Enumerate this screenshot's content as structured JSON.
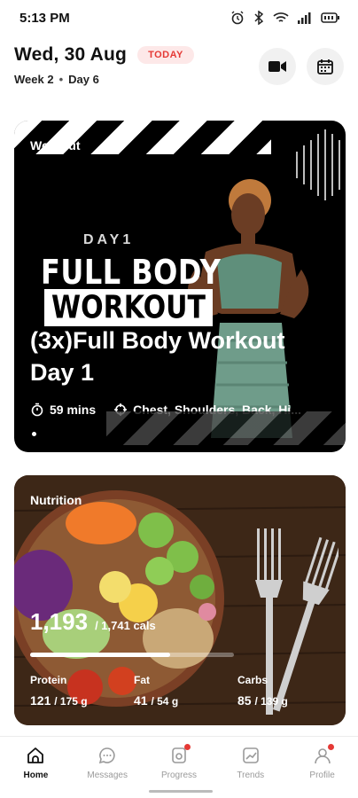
{
  "status_bar": {
    "time": "5:13 PM"
  },
  "header": {
    "date": "Wed, 30 Aug",
    "today_badge": "TODAY",
    "week": "Week 2",
    "separator": "•",
    "day": "Day 6"
  },
  "workout": {
    "section_label": "Workout",
    "banner_day": "DAY1",
    "banner_line1": "FULL BODY",
    "banner_line2": "WORKOUT",
    "title": "(3x)Full Body Workout Day 1",
    "duration": "59 mins",
    "muscles": "Chest, Shoulders, Back, Hi..."
  },
  "nutrition": {
    "section_label": "Nutrition",
    "calories_eaten": "1,193",
    "calories_goal": "/ 1,741 cals",
    "calorie_progress": 0.685,
    "macros": [
      {
        "name": "Protein",
        "value": "121",
        "total": "/ 175 g"
      },
      {
        "name": "Fat",
        "value": "41",
        "total": "/ 54 g"
      },
      {
        "name": "Carbs",
        "value": "85",
        "total": "/ 139 g"
      }
    ]
  },
  "bottom_nav": {
    "items": [
      {
        "label": "Home",
        "icon": "home-icon",
        "active": true,
        "badge": false
      },
      {
        "label": "Messages",
        "icon": "chat-icon",
        "active": false,
        "badge": false
      },
      {
        "label": "Progress",
        "icon": "camera-icon",
        "active": false,
        "badge": true
      },
      {
        "label": "Trends",
        "icon": "trend-icon",
        "active": false,
        "badge": false
      },
      {
        "label": "Profile",
        "icon": "profile-icon",
        "active": false,
        "badge": true
      }
    ]
  },
  "colors": {
    "accent": "#e53935",
    "badge_bg": "#fde8e8"
  }
}
